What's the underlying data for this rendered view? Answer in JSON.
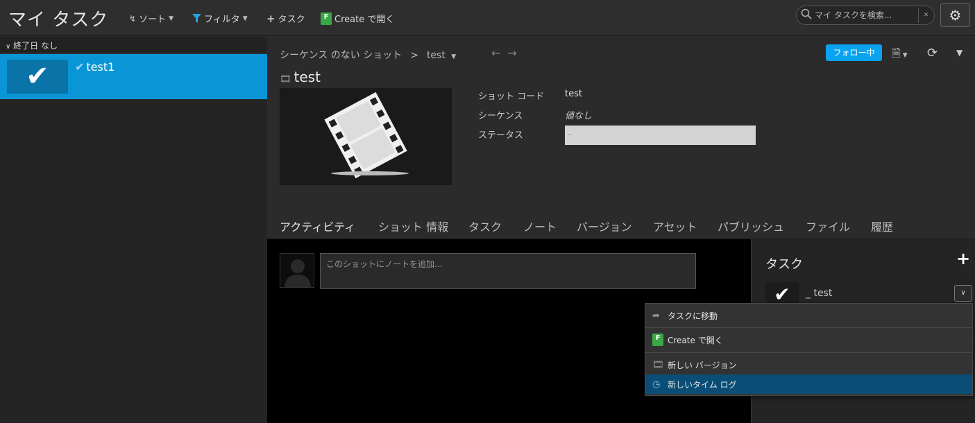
{
  "header": {
    "title": "マイ タスク",
    "sort_label": "ソート",
    "filter_label": "フィルタ",
    "add_task_label": "タスク",
    "open_in_label": "Create で開く",
    "search_placeholder": "マイ タスクを検索..."
  },
  "left": {
    "group_label": "終了日 なし",
    "tasks": [
      {
        "name": "test1"
      }
    ]
  },
  "main": {
    "breadcrumb": {
      "parent": "シーケンス のない ショット",
      "current": "test"
    },
    "follow_label": "フォロー中",
    "entity_title": "test",
    "fields": [
      {
        "label": "ショット コード",
        "value": "test"
      },
      {
        "label": "シーケンス",
        "value": "値なし"
      },
      {
        "label": "ステータス",
        "value": "-"
      }
    ],
    "tabs": [
      "アクティビティ",
      "ショット 情報",
      "タスク",
      "ノート",
      "バージョン",
      "アセット",
      "パブリッシュ",
      "ファイル",
      "履歴"
    ],
    "note_placeholder": "このショットにノートを追加...",
    "task_panel": {
      "title": "タスク",
      "item_name": "_ test"
    }
  },
  "context_menu": {
    "items": [
      "タスクに移動",
      "Create で開く",
      "新しい バージョン",
      "新しいタイム ログ"
    ],
    "highlighted": "新しいタイム ログ"
  },
  "colors": {
    "accent": "#0a96d6",
    "follow": "#0aa3ef",
    "menu_highlight": "#0a4e78"
  }
}
